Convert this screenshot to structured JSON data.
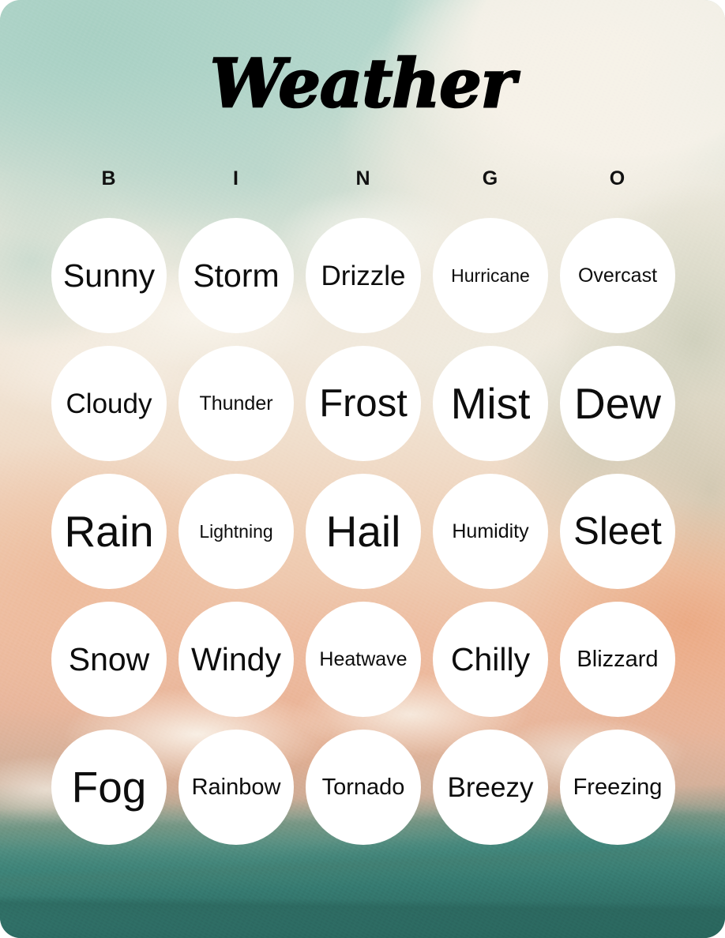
{
  "card": {
    "title": "Weather",
    "corner_radius_px": 26,
    "palette": {
      "mint": "#aed3c8",
      "cream": "#f0ebe0",
      "peach": "#eebfa4",
      "salmon": "#ea9f76",
      "teal": "#3a8079",
      "deep_teal": "#2d6b5f",
      "cell_fill": "#ffffff",
      "text": "#0d0d0d"
    }
  },
  "header": {
    "letters": [
      "B",
      "I",
      "N",
      "G",
      "O"
    ]
  },
  "grid": {
    "columns": 5,
    "rows": 5,
    "cells": [
      [
        {
          "label": "Sunny",
          "size_class": "len-5"
        },
        {
          "label": "Storm",
          "size_class": "len-5"
        },
        {
          "label": "Drizzle",
          "size_class": "len-6"
        },
        {
          "label": "Hurricane",
          "size_class": "len-9"
        },
        {
          "label": "Overcast",
          "size_class": "len-8"
        }
      ],
      [
        {
          "label": "Cloudy",
          "size_class": "len-6"
        },
        {
          "label": "Thunder",
          "size_class": "len-8"
        },
        {
          "label": "Frost",
          "size_class": "len-4"
        },
        {
          "label": "Mist",
          "size_class": "len-3"
        },
        {
          "label": "Dew",
          "size_class": "len-3"
        }
      ],
      [
        {
          "label": "Rain",
          "size_class": "len-3"
        },
        {
          "label": "Lightning",
          "size_class": "len-9"
        },
        {
          "label": "Hail",
          "size_class": "len-3"
        },
        {
          "label": "Humidity",
          "size_class": "len-8"
        },
        {
          "label": "Sleet",
          "size_class": "len-4"
        }
      ],
      [
        {
          "label": "Snow",
          "size_class": "len-5"
        },
        {
          "label": "Windy",
          "size_class": "len-5"
        },
        {
          "label": "Heatwave",
          "size_class": "len-8"
        },
        {
          "label": "Chilly",
          "size_class": "len-5"
        },
        {
          "label": "Blizzard",
          "size_class": "len-7"
        }
      ],
      [
        {
          "label": "Fog",
          "size_class": "len-3"
        },
        {
          "label": "Rainbow",
          "size_class": "len-7"
        },
        {
          "label": "Tornado",
          "size_class": "len-7"
        },
        {
          "label": "Breezy",
          "size_class": "len-6"
        },
        {
          "label": "Freezing",
          "size_class": "len-7"
        }
      ]
    ]
  }
}
